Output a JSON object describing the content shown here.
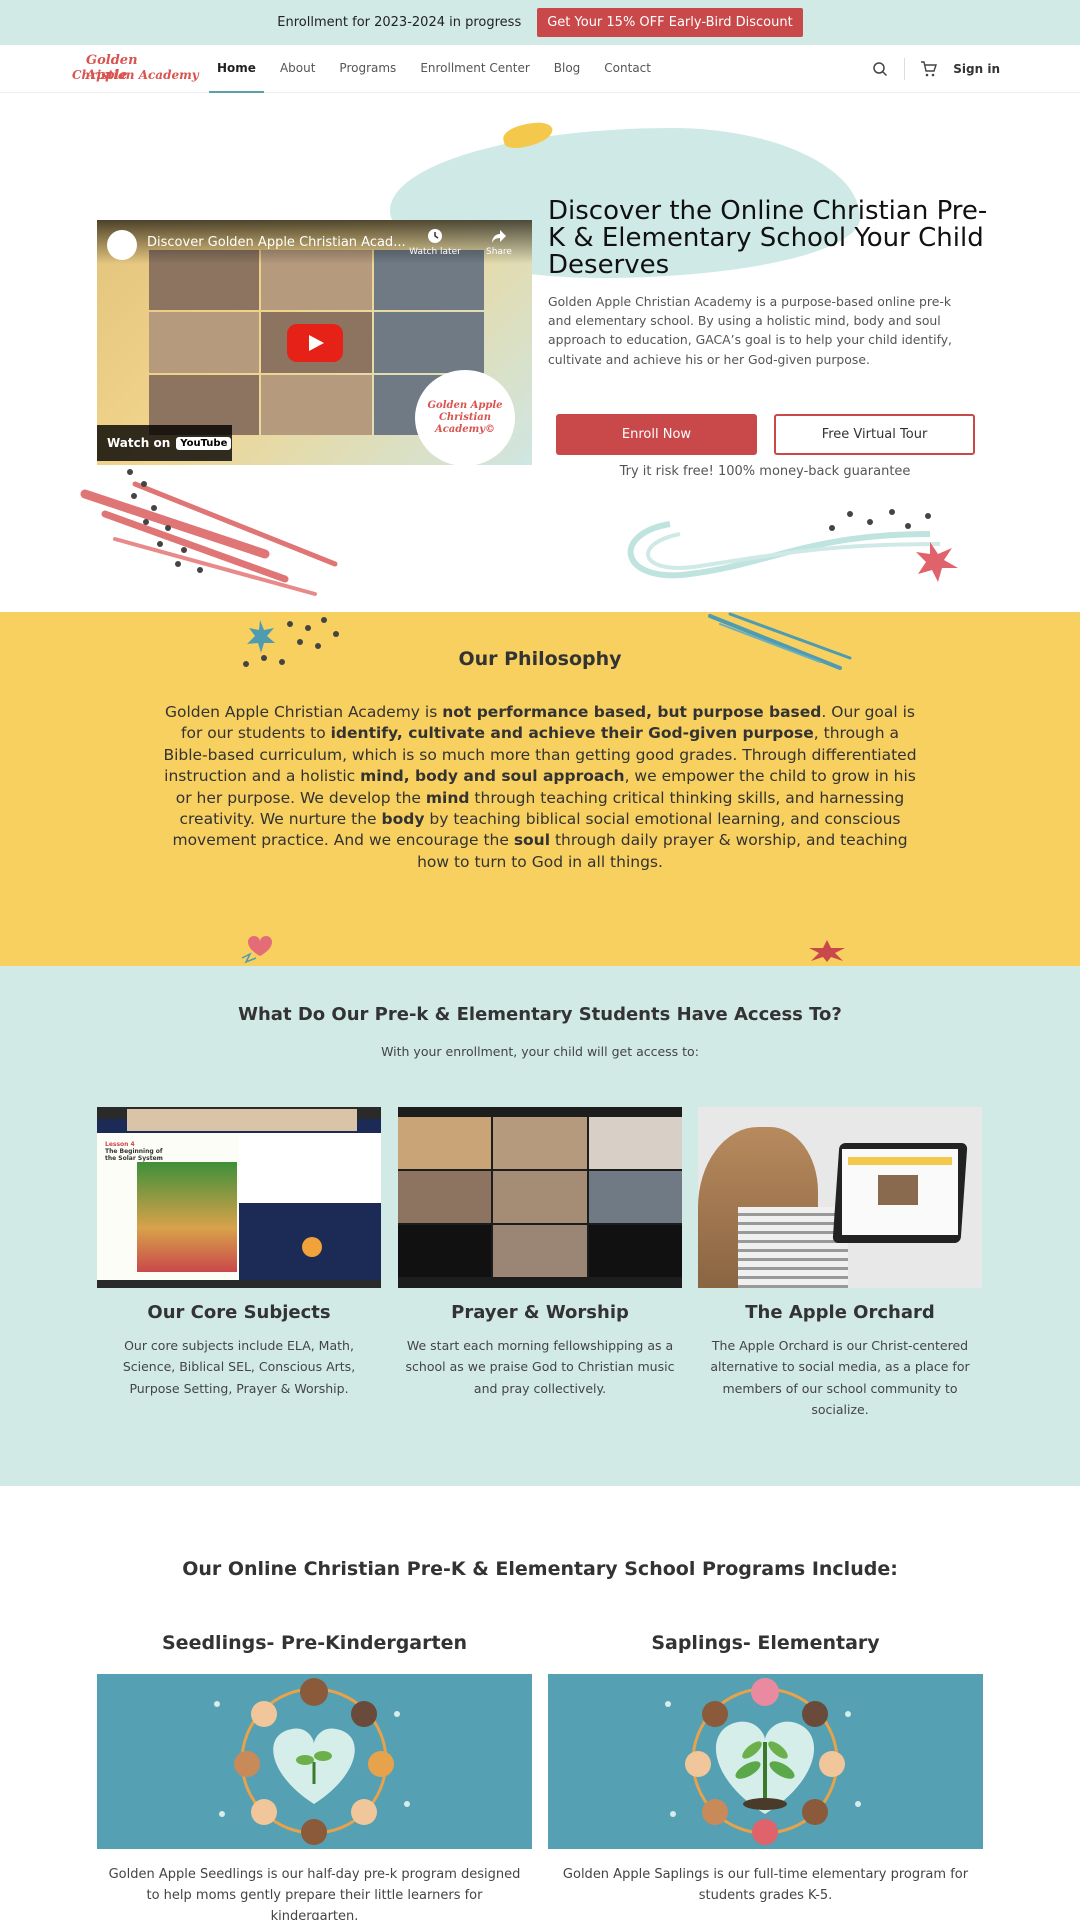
{
  "topbar": {
    "message": "Enrollment for 2023-2024 in progress",
    "promo_label": "Get Your 15% OFF Early-Bird Discount"
  },
  "header": {
    "logo_line1": "Golden Apple",
    "logo_line2": "Christian Academy",
    "nav": [
      "Home",
      "About",
      "Programs",
      "Enrollment Center",
      "Blog",
      "Contact"
    ],
    "active_nav": "Home",
    "signin_label": "Sign in",
    "icons": [
      "search-icon",
      "cart-icon"
    ]
  },
  "hero": {
    "video": {
      "title": "Discover Golden Apple Christian Acad...",
      "watch_later": "Watch later",
      "share": "Share",
      "watch_on": "Watch on",
      "youtube": "YouTube",
      "badge_line1": "Golden Apple",
      "badge_line2": "Christian Academy©"
    },
    "title": "Discover the Online Christian Pre-K & Elementary School Your Child Deserves",
    "description": "Golden Apple Christian Academy is a purpose-based online pre-k and elementary school. By using a holistic mind, body and soul approach to education, GACA’s goal is to help your child identify, cultivate and achieve his or her God-given purpose.",
    "enroll_label": "Enroll Now",
    "tour_label": "Free Virtual Tour",
    "guarantee": "Try it risk free! 100% money-back guarantee"
  },
  "philosophy": {
    "title": "Our Philosophy",
    "parts": [
      "Golden Apple Christian Academy is ",
      "not performance based, but purpose based",
      ". Our goal is for our students to ",
      "identify, cultivate and achieve their God-given purpose",
      ", through a Bible-based curriculum, which is so much more than getting good grades. Through differentiated instruction and a holistic ",
      "mind, body and soul approach",
      ", we empower the child to grow in his or her purpose.  We develop the ",
      "mind",
      " through teaching critical thinking skills, and harnessing creativity.  We nurture the ",
      "body",
      " by teaching biblical social emotional learning, and conscious movement practice. And we encourage the ",
      "soul",
      " through daily prayer & worship, and teaching how to turn to God in all things."
    ]
  },
  "access": {
    "title": "What Do Our Pre-k & Elementary Students Have Access To?",
    "subtitle": "With your enrollment, your child will get access to:",
    "cards": [
      {
        "title": "Our Core Subjects",
        "desc": "Our core subjects include ELA, Math, Science, Biblical SEL, Conscious Arts, Purpose Setting, Prayer & Worship.",
        "page_heading": "The Beginning of the Solar System",
        "lesson": "Lesson 4"
      },
      {
        "title": "Prayer & Worship",
        "desc": "We start each morning fellowshipping as a school as we praise God to Christian music and pray collectively."
      },
      {
        "title": "The Apple Orchard",
        "desc": "The Apple Orchard is our Christ-centered alternative to social media, as a place for members of our school community to socialize."
      }
    ]
  },
  "programs": {
    "title": "Our Online Christian Pre-K & Elementary School Programs Include:",
    "items": [
      {
        "name": "Seedlings- Pre-Kindergarten",
        "desc": "Golden Apple Seedlings is our half-day pre-k program designed to help moms gently prepare their little learners for kindergarten."
      },
      {
        "name": "Saplings- Elementary",
        "desc": "Golden Apple Saplings is our full-time elementary program for students grades K-5."
      }
    ]
  },
  "colors": {
    "mint": "#d2eae6",
    "yellow": "#f7d060",
    "red": "#c9484a",
    "teal": "#55a0b2"
  }
}
